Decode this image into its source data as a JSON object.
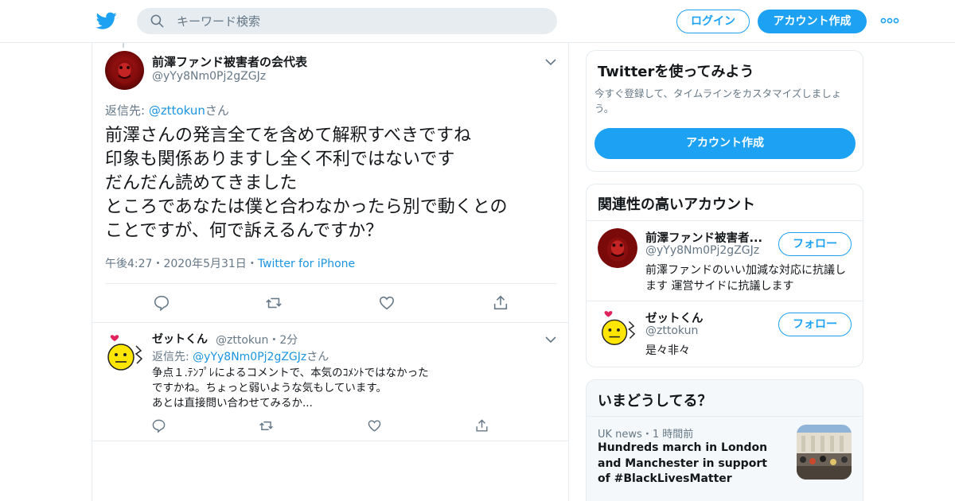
{
  "header": {
    "search_placeholder": "キーワード検索",
    "login_label": "ログイン",
    "signup_label": "アカウント作成"
  },
  "tweet": {
    "author_name": "前澤ファンド被害者の会代表",
    "author_handle": "@yYy8Nm0Pj2gZGJz",
    "reply_prefix": "返信先: ",
    "reply_mention": "@zttokun",
    "reply_suffix": "さん",
    "text": "前澤さんの発言全てを含めて解釈すべきですね\n印象も関係ありますし全く不利ではないです\nだんだん読めてきました\nところであなたは僕と合わなかったら別で動くとの\nことですが、何で訴えるんですか？",
    "time": "午後4:27",
    "date": "2020年5月31日",
    "source": "Twitter for iPhone",
    "sep": "・"
  },
  "reply": {
    "author_name": "ゼットくん",
    "author_handle": "@zttokun",
    "age": "2分",
    "sep": "・",
    "reply_prefix": "返信先: ",
    "reply_mention": "@yYy8Nm0Pj2gZGJz",
    "reply_suffix": "さん",
    "text": "争点１.ﾃﾝﾌﾟﾚによるコメントで、本気のｺﾒﾝﾄではなかった\nですかね。ちょっと弱いような気もしています。\nあとは直接問い合わせてみるか..."
  },
  "signup_card": {
    "title": "Twitterを使ってみよう",
    "description": "今すぐ登録して、タイムラインをカスタマイズしましょう。",
    "button": "アカウント作成"
  },
  "related_card": {
    "title": "関連性の高いアカウント",
    "accounts": [
      {
        "name": "前澤ファンド被害者...",
        "handle": "@yYy8Nm0Pj2gZGJz",
        "bio": "前澤ファンドのいい加減な対応に抗議します 運営サイドに抗議します",
        "follow_label": "フォロー"
      },
      {
        "name": "ゼットくん",
        "handle": "@zttokun",
        "bio": "是々非々",
        "follow_label": "フォロー"
      }
    ]
  },
  "trends_card": {
    "title": "いまどうしてる？",
    "items": [
      {
        "source": "UK news",
        "sep": "・",
        "age": "1 時間前",
        "text": "Hundreds march in London and Manchester in support of #BlackLivesMatter"
      }
    ]
  },
  "colors": {
    "brand": "#1da1f2",
    "link": "#1b95e0",
    "muted": "#657786",
    "border": "#e6ecf0"
  },
  "icons": {
    "logo": "twitter-bird-icon",
    "search": "search-icon",
    "more": "more-dots-icon",
    "chevron": "chevron-down-icon",
    "reply": "reply-icon",
    "retweet": "retweet-icon",
    "like": "heart-icon",
    "share": "share-icon"
  }
}
